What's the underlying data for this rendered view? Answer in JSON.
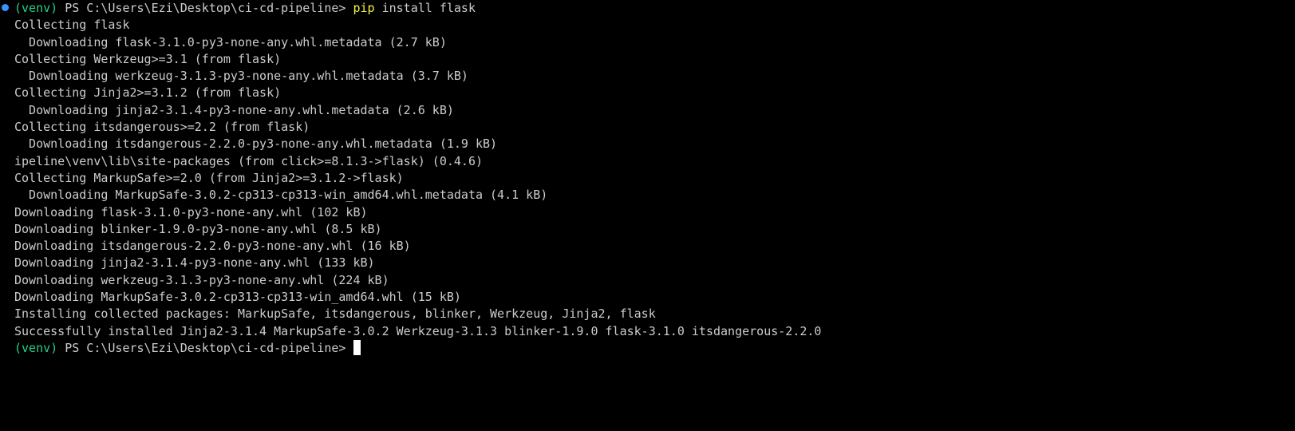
{
  "colors": {
    "background": "#000000",
    "text": "#cccccc",
    "venv": "#23d18b",
    "command": "#f5f543",
    "decoration": "#3794ff"
  },
  "prompt": {
    "venv": "(venv)",
    "path": "PS C:\\Users\\Ezi\\Desktop\\ci-cd-pipeline>"
  },
  "command": {
    "name": "pip",
    "args": "install flask"
  },
  "output": [
    "Collecting flask",
    "  Downloading flask-3.1.0-py3-none-any.whl.metadata (2.7 kB)",
    "Collecting Werkzeug>=3.1 (from flask)",
    "  Downloading werkzeug-3.1.3-py3-none-any.whl.metadata (3.7 kB)",
    "Collecting Jinja2>=3.1.2 (from flask)",
    "  Downloading jinja2-3.1.4-py3-none-any.whl.metadata (2.6 kB)",
    "Collecting itsdangerous>=2.2 (from flask)",
    "  Downloading itsdangerous-2.2.0-py3-none-any.whl.metadata (1.9 kB)",
    "ipeline\\venv\\lib\\site-packages (from click>=8.1.3->flask) (0.4.6)",
    "Collecting MarkupSafe>=2.0 (from Jinja2>=3.1.2->flask)",
    "  Downloading MarkupSafe-3.0.2-cp313-cp313-win_amd64.whl.metadata (4.1 kB)",
    "Downloading flask-3.1.0-py3-none-any.whl (102 kB)",
    "Downloading blinker-1.9.0-py3-none-any.whl (8.5 kB)",
    "Downloading itsdangerous-2.2.0-py3-none-any.whl (16 kB)",
    "Downloading jinja2-3.1.4-py3-none-any.whl (133 kB)",
    "Downloading werkzeug-3.1.3-py3-none-any.whl (224 kB)",
    "Downloading MarkupSafe-3.0.2-cp313-cp313-win_amd64.whl (15 kB)",
    "Installing collected packages: MarkupSafe, itsdangerous, blinker, Werkzeug, Jinja2, flask",
    "Successfully installed Jinja2-3.1.4 MarkupSafe-3.0.2 Werkzeug-3.1.3 blinker-1.9.0 flask-3.1.0 itsdangerous-2.2.0"
  ],
  "final_prompt": {
    "venv": "(venv)",
    "path": "PS C:\\Users\\Ezi\\Desktop\\ci-cd-pipeline>"
  }
}
